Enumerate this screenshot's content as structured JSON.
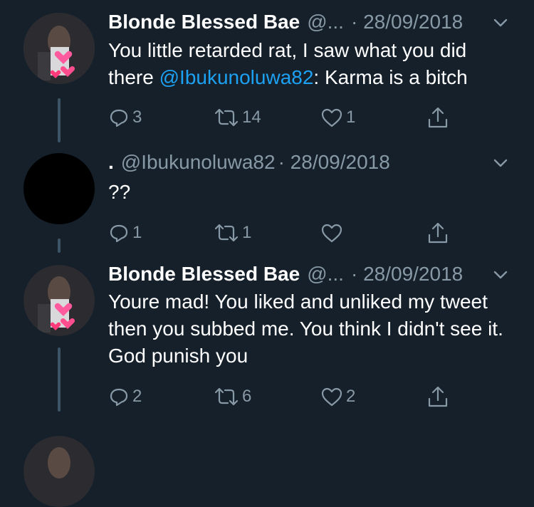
{
  "tweets": [
    {
      "name": "Blonde Blessed Bae",
      "handle": "@...",
      "date": "· 28/09/2018",
      "text_before": "You little retarded rat, I saw what you did there ",
      "mention": "@Ibukunoluwa82",
      "text_after": ": Karma is a bitch",
      "replies": "3",
      "retweets": "14",
      "likes": "1"
    },
    {
      "name": ".",
      "handle": "@Ibukunoluwa82",
      "date": "· 28/09/2018",
      "text": "??",
      "replies": "1",
      "retweets": "1",
      "likes": ""
    },
    {
      "name": "Blonde Blessed Bae",
      "handle": "@...",
      "date": "· 28/09/2018",
      "text": "Youre mad! You liked and unliked my tweet then you subbed me. You think  I didn't see it. God punish you",
      "replies": "2",
      "retweets": "6",
      "likes": "2"
    }
  ],
  "colors": {
    "background": "#15202b",
    "secondary_text": "#8899a6",
    "link": "#1da1f2",
    "thread_line": "#3d5466"
  },
  "icons": [
    "reply-icon",
    "retweet-icon",
    "like-icon",
    "share-icon",
    "chevron-down-icon"
  ]
}
